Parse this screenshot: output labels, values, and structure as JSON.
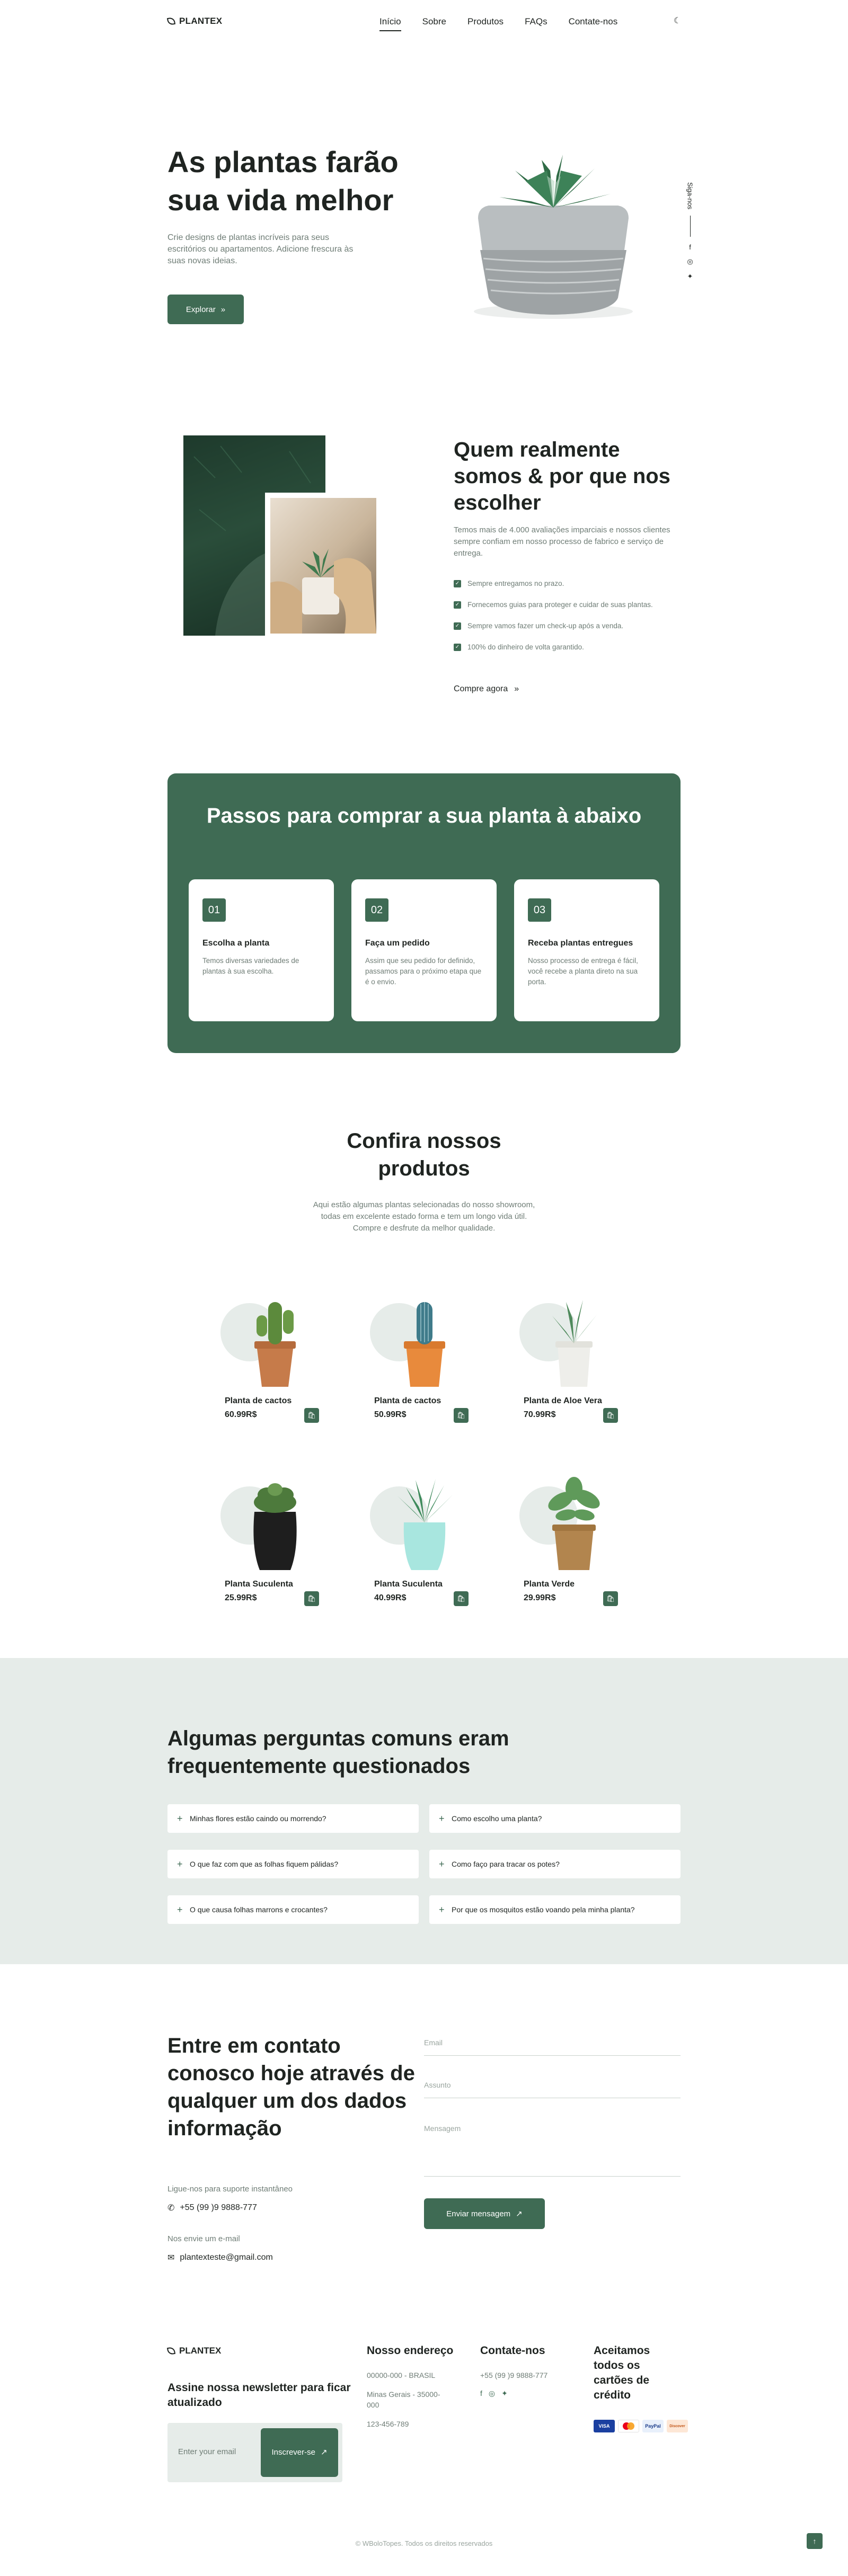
{
  "header": {
    "brand": "PLANTEX",
    "nav": [
      "Início",
      "Sobre",
      "Produtos",
      "FAQs",
      "Contate-nos"
    ],
    "theme_icon": "moon-icon"
  },
  "hero": {
    "title": "As plantas farão sua vida melhor",
    "description": "Crie designs de plantas incríveis para seus escritórios ou apartamentos. Adicione frescura às suas novas ideias.",
    "button": "Explorar",
    "follow": "Siga-nos",
    "social_icons": [
      "facebook-icon",
      "instagram-icon",
      "twitter-icon"
    ]
  },
  "about": {
    "title": "Quem realmente somos & por que nos escolher",
    "description": "Temos mais de 4.000 avaliações imparciais e nossos clientes sempre confiam em nosso processo de fabrico e serviço de entrega.",
    "checks": [
      "Sempre entregamos no prazo.",
      "Fornecemos guias para proteger e cuidar de suas plantas.",
      "Sempre vamos fazer um check-up após a venda.",
      "100% do dinheiro de volta garantido."
    ],
    "link": "Compre agora"
  },
  "steps": {
    "title": "Passos para comprar a sua planta à abaixo",
    "items": [
      {
        "num": "01",
        "title": "Escolha a planta",
        "text": "Temos diversas variedades de plantas à sua escolha."
      },
      {
        "num": "02",
        "title": "Faça um pedido",
        "text": "Assim que seu pedido for definido, passamos para o próximo etapa que é o envio."
      },
      {
        "num": "03",
        "title": "Receba plantas entregues",
        "text": "Nosso processo de entrega é fácil, você recebe a planta direto na sua porta."
      }
    ]
  },
  "products": {
    "title": "Confira nossos produtos",
    "description": "Aqui estão algumas plantas selecionadas do nosso showroom, todas em excelente estado forma e tem um longo vida útil. Compre e desfrute da melhor qualidade.",
    "items": [
      {
        "name": "Planta de cactos",
        "price": "60.99R$"
      },
      {
        "name": "Planta de cactos",
        "price": "50.99R$"
      },
      {
        "name": "Planta de Aloe Vera",
        "price": "70.99R$"
      },
      {
        "name": "Planta Suculenta",
        "price": "25.99R$"
      },
      {
        "name": "Planta Suculenta",
        "price": "40.99R$"
      },
      {
        "name": "Planta Verde",
        "price": "29.99R$"
      }
    ]
  },
  "faq": {
    "title": "Algumas perguntas comuns eram frequentemente questionados",
    "items": [
      "Minhas flores estão caindo ou morrendo?",
      "Como escolho uma planta?",
      "O que faz com que as folhas fiquem pálidas?",
      "Como faço para tracar os potes?",
      "O que causa folhas marrons e crocantes?",
      "Por que os mosquitos estão voando pela minha planta?"
    ]
  },
  "contact": {
    "title": "Entre em contato conosco hoje através de qualquer um dos dados informação",
    "support_label": "Ligue-nos para suporte instantâneo",
    "phone": "+55 (99 )9 9888-777",
    "email_label": "Nos envie um e-mail",
    "email": "plantexteste@gmail.com",
    "form": {
      "email": "Email",
      "subject": "Assunto",
      "message": "Mensagem",
      "button": "Enviar mensagem"
    }
  },
  "footer": {
    "brand": "PLANTEX",
    "newsletter_title": "Assine nossa newsletter para ficar atualizado",
    "newsletter_placeholder": "Enter your email",
    "subscribe": "Inscrever-se",
    "address_title": "Nosso endereço",
    "address_lines": [
      "00000-000 - BRASIL",
      "Minas Gerais - 35000-000",
      "123-456-789"
    ],
    "contact_title": "Contate-nos",
    "contact_phone": "+55 (99 )9 9888-777",
    "cards_title": "Aceitamos todos os cartões de crédito",
    "cards": [
      "VISA",
      "MC",
      "PayPal",
      "Discover"
    ],
    "copyright": "© WBoloTopes. Todos os direitos reservados"
  }
}
